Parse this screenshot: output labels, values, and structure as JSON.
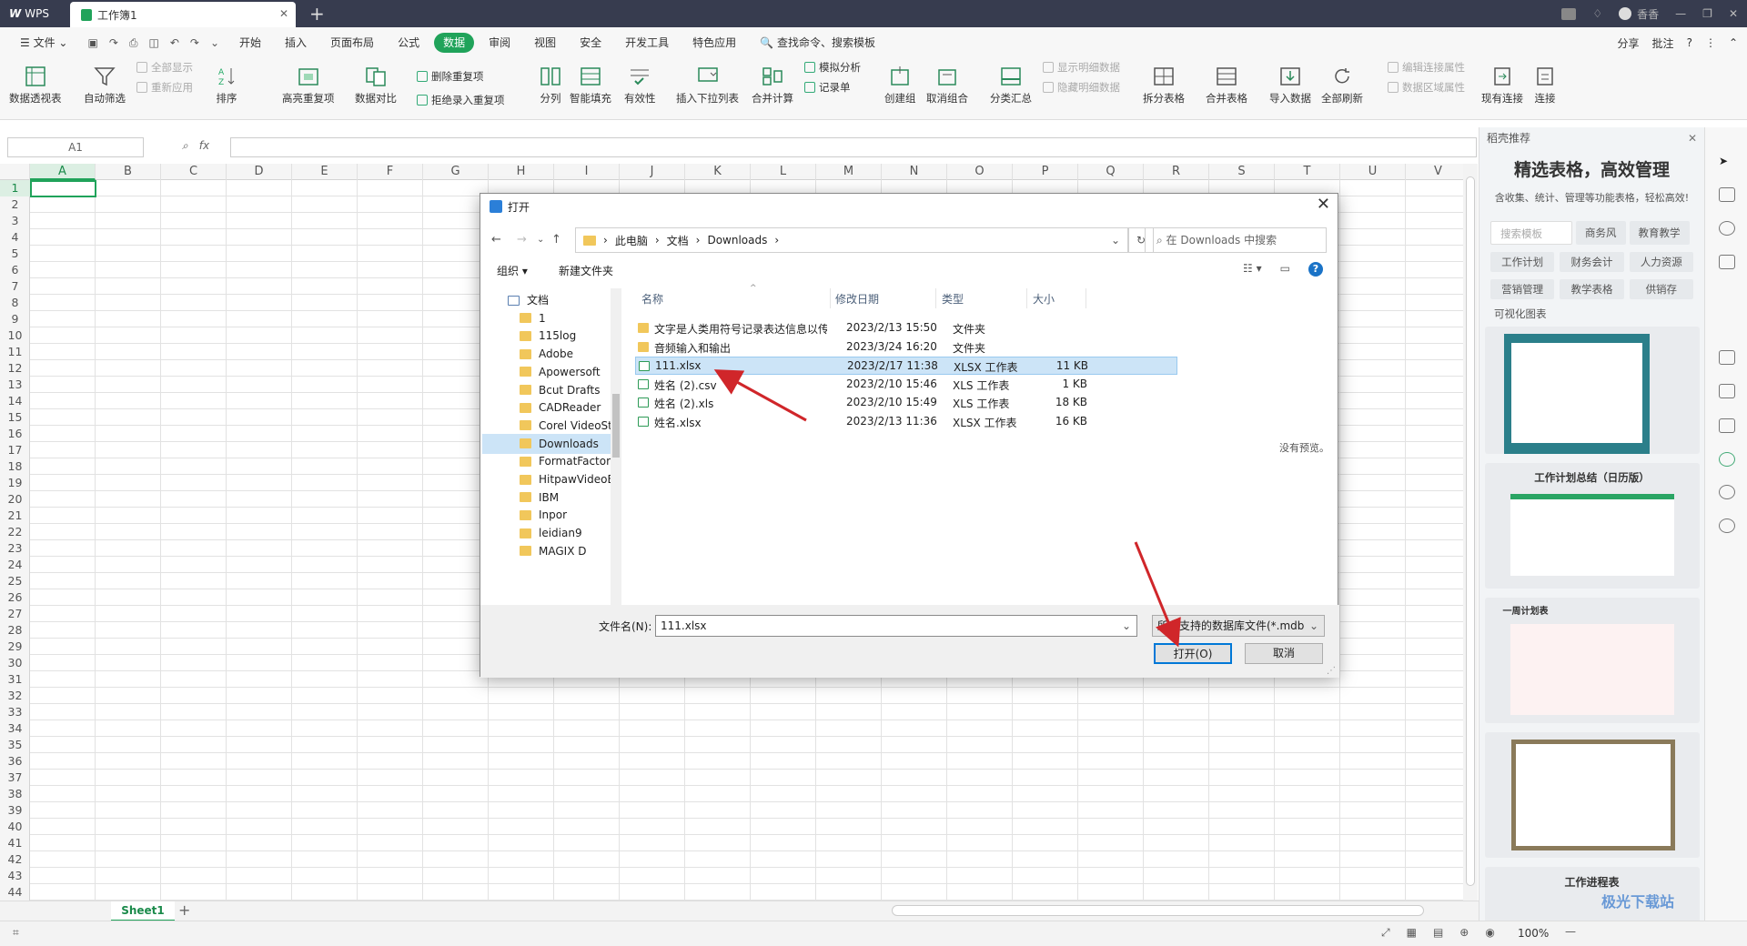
{
  "titlebar": {
    "app": "WPS",
    "doc_tab": "工作簿1",
    "new_tab": "+",
    "user": "香香"
  },
  "menubar": {
    "file": "文件",
    "tabs": [
      "开始",
      "插入",
      "页面布局",
      "公式",
      "数据",
      "审阅",
      "视图",
      "安全",
      "开发工具",
      "特色应用"
    ],
    "active_tab": "数据",
    "search": "查找命令、搜索模板",
    "right": [
      "分享",
      "批注",
      "?"
    ]
  },
  "ribbon": {
    "pivot": "数据透视表",
    "autofilter": "自动筛选",
    "show_all": "全部显示",
    "reapply": "重新应用",
    "sort": "排序",
    "highlight_dup": "高亮重复项",
    "compare": "数据对比",
    "remove_dup": "删除重复项",
    "reject_dup": "拒绝录入重复项",
    "split_col": "分列",
    "smart_fill": "智能填充",
    "validity": "有效性",
    "dropdown": "插入下拉列表",
    "consolidate": "合并计算",
    "simulate": "模拟分析",
    "record": "记录单",
    "group": "创建组",
    "ungroup": "取消组合",
    "subtotal": "分类汇总",
    "show_detail": "显示明细数据",
    "hide_detail": "隐藏明细数据",
    "split_table": "拆分表格",
    "merge_table": "合并表格",
    "import": "导入数据",
    "refresh_all": "全部刷新",
    "edit_link": "编辑连接属性",
    "range_prop": "数据区域属性",
    "existing_conn": "现有连接",
    "connect": "连接"
  },
  "formula_bar": {
    "cell": "A1",
    "fx": "fx",
    "value": ""
  },
  "sheet": {
    "columns": [
      "A",
      "B",
      "C",
      "D",
      "E",
      "F",
      "G",
      "H",
      "I",
      "J",
      "K",
      "L",
      "M",
      "N",
      "O",
      "P",
      "Q",
      "R",
      "S",
      "T",
      "U",
      "V"
    ],
    "rows": [
      "1",
      "2",
      "3",
      "4",
      "5",
      "6",
      "7",
      "8",
      "9",
      "10",
      "11",
      "12",
      "13",
      "14",
      "15",
      "16",
      "17",
      "18",
      "19",
      "20",
      "21",
      "22",
      "23",
      "24",
      "25",
      "26",
      "27",
      "28",
      "29",
      "30",
      "31",
      "32",
      "33",
      "34",
      "35",
      "36",
      "37",
      "38",
      "39",
      "40",
      "41",
      "42",
      "43",
      "44"
    ],
    "tab": "Sheet1",
    "zoom": "100%"
  },
  "right_pane": {
    "header": "稻壳推荐",
    "title": "精选表格，高效管理",
    "subtitle": "含收集、统计、管理等功能表格，轻松高效!",
    "search_placeholder": "搜索模板",
    "tags_row0": [
      "商务风",
      "教育教学"
    ],
    "tags_row1": [
      "工作计划",
      "财务会计",
      "人力资源"
    ],
    "tags_row2": [
      "营销管理",
      "教学表格",
      "供销存"
    ],
    "vis_label": "可视化图表",
    "card_titles": [
      "工作计划总结（日历版）",
      "一周计划表",
      "工作进程表"
    ]
  },
  "dialog": {
    "title": "打开",
    "breadcrumb": [
      "此电脑",
      "文档",
      "Downloads"
    ],
    "search_placeholder": "在 Downloads 中搜索",
    "organize": "组织 ▾",
    "new_folder": "新建文件夹",
    "tree": [
      {
        "label": "文档"
      },
      {
        "label": "1"
      },
      {
        "label": "115log"
      },
      {
        "label": "Adobe"
      },
      {
        "label": "Apowersoft"
      },
      {
        "label": "Bcut Drafts"
      },
      {
        "label": "CADReader"
      },
      {
        "label": "Corel VideoSt"
      },
      {
        "label": "Downloads"
      },
      {
        "label": "FormatFactor"
      },
      {
        "label": "HitpawVideoE"
      },
      {
        "label": "IBM"
      },
      {
        "label": "Inpor"
      },
      {
        "label": "leidian9"
      },
      {
        "label": "MAGIX D"
      }
    ],
    "columns": {
      "name": "名称",
      "date": "修改日期",
      "type": "类型",
      "size": "大小"
    },
    "files": [
      {
        "name": "文字是人类用符号记录表达信息以传之久...",
        "date": "2023/2/13 15:50",
        "type": "文件夹",
        "size": "",
        "kind": "folder"
      },
      {
        "name": "音频输入和输出",
        "date": "2023/3/24 16:20",
        "type": "文件夹",
        "size": "",
        "kind": "folder"
      },
      {
        "name": "111.xlsx",
        "date": "2023/2/17 11:38",
        "type": "XLSX 工作表",
        "size": "11 KB",
        "kind": "xls"
      },
      {
        "name": "姓名 (2).csv",
        "date": "2023/2/10 15:46",
        "type": "XLS 工作表",
        "size": "1 KB",
        "kind": "xls"
      },
      {
        "name": "姓名 (2).xls",
        "date": "2023/2/10 15:49",
        "type": "XLS 工作表",
        "size": "18 KB",
        "kind": "xls"
      },
      {
        "name": "姓名.xlsx",
        "date": "2023/2/13 11:36",
        "type": "XLSX 工作表",
        "size": "16 KB",
        "kind": "xls"
      }
    ],
    "no_preview": "没有预览。",
    "filename_label": "文件名(N):",
    "filename_value": "111.xlsx",
    "filetype": "所有支持的数据库文件(*.mdb",
    "open_button": "打开(O)",
    "cancel_button": "取消"
  },
  "watermark": "极光下载站",
  "colors": {
    "accent": "#20a35a",
    "selection": "#cce4f7",
    "arrow": "#d0262a"
  }
}
